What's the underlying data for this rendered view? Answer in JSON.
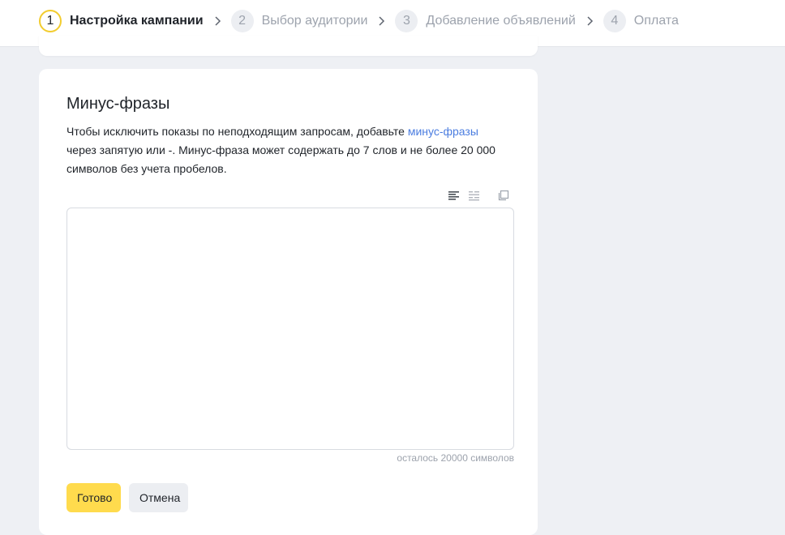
{
  "stepper": {
    "steps": [
      {
        "number": "1",
        "label": "Настройка кампании",
        "active": true
      },
      {
        "number": "2",
        "label": "Выбор аудитории",
        "active": false
      },
      {
        "number": "3",
        "label": "Добавление объявлений",
        "active": false
      },
      {
        "number": "4",
        "label": "Оплата",
        "active": false
      }
    ]
  },
  "minus_phrases": {
    "title": "Минус-фразы",
    "description_before_link": "Чтобы исключить показы по неподходящим запросам, добавьте ",
    "link_text": "минус-фразы",
    "description_after_link": " через запятую или -. Минус-фраза может содержать до 7 слов и не более 20 000 символов без учета пробелов.",
    "input_value": "",
    "counter_text": "осталось 20000 символов",
    "tools": [
      "align-left-icon",
      "list-view-icon",
      "copy-icon"
    ]
  },
  "actions": {
    "done_label": "Готово",
    "cancel_label": "Отмена"
  },
  "colors": {
    "accent_yellow": "#ffdb4d",
    "active_step_ring": "#f2cc2e",
    "link_blue": "#4b7de0",
    "page_bg": "#eef0f4"
  }
}
